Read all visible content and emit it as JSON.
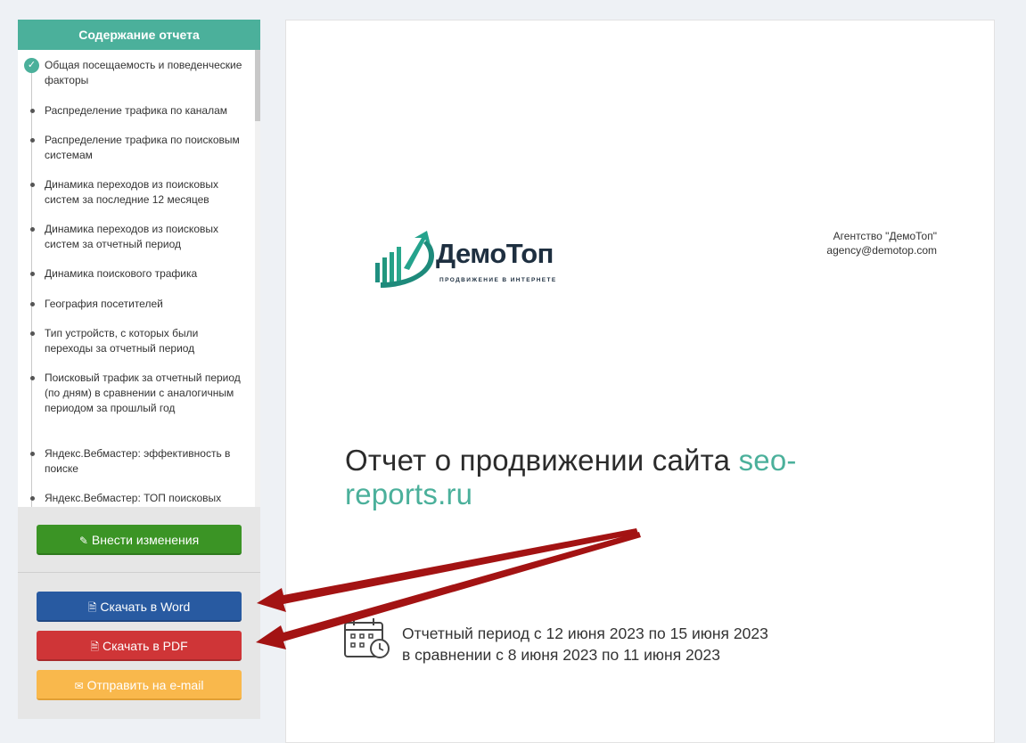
{
  "sidebar": {
    "header": "Содержание отчета",
    "items": [
      {
        "label": "Общая посещаемость и поведенческие факторы",
        "done": true
      },
      {
        "label": "Распределение трафика по каналам",
        "done": false
      },
      {
        "label": "Распределение трафика по поисковым системам",
        "done": false
      },
      {
        "label": "Динамика переходов из поисковых систем за последние 12 месяцев",
        "done": false
      },
      {
        "label": "Динамика переходов из поисковых систем за отчетный период",
        "done": false
      },
      {
        "label": "Динамика поискового трафика",
        "done": false
      },
      {
        "label": "География посетителей",
        "done": false
      },
      {
        "label": "Тип устройств, с которых были переходы за отчетный период",
        "done": false
      },
      {
        "label": "Поисковый трафик за отчетный период (по дням) в сравнении с аналогичным периодом за прошлый год",
        "done": false
      },
      {
        "label": "Яндекс.Вебмастер: эффективность в поиске",
        "done": false
      },
      {
        "label": "Яндекс.Вебмастер: ТОП поисковых",
        "done": false
      }
    ],
    "buttons": {
      "edit": "Внести изменения",
      "word": "Скачать в Word",
      "pdf": "Скачать в PDF",
      "email": "Отправить на e-mail"
    }
  },
  "report": {
    "logo_name": "ДемоТоп",
    "logo_tagline": "ПРОДВИЖЕНИЕ В ИНТЕРНЕТЕ",
    "agency_name": "Агентство \"ДемоТоп\"",
    "agency_email": "agency@demotop.com",
    "title_prefix": "Отчет о продвижении сайта",
    "site": "seo-reports.ru",
    "period_line1": "Отчетный период с 12 июня 2023 по 15 июня 2023",
    "period_line2": "в сравнении с 8 июня 2023 по 11 июня 2023"
  },
  "colors": {
    "accent": "#4bb09b",
    "edit_button": "#3b9425",
    "word_button": "#285aa1",
    "pdf_button": "#cf3537",
    "email_button": "#f9b84c",
    "arrow": "#a31313"
  }
}
